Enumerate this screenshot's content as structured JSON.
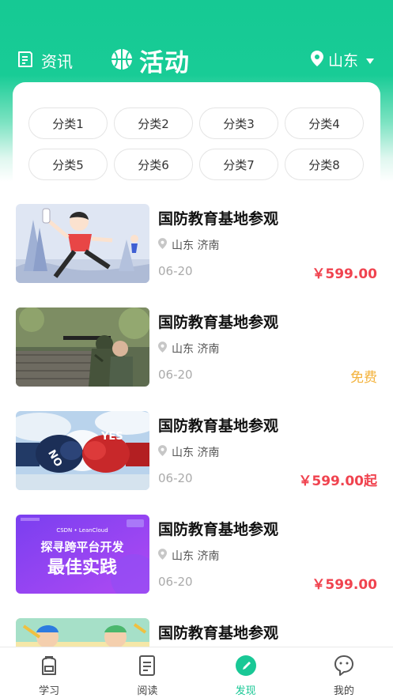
{
  "header": {
    "news_label": "资讯",
    "title": "活动",
    "location": "山东"
  },
  "categories": [
    "分类1",
    "分类2",
    "分类3",
    "分类4",
    "分类5",
    "分类6",
    "分类7",
    "分类8"
  ],
  "activities": [
    {
      "title": "国防教育基地参观",
      "location": "山东 济南",
      "date": "06-20",
      "price": "￥599.00",
      "free": false,
      "image": "cartoon-runner"
    },
    {
      "title": "国防教育基地参观",
      "location": "山东 济南",
      "date": "06-20",
      "price": "免费",
      "free": true,
      "image": "shooting-training"
    },
    {
      "title": "国防教育基地参观",
      "location": "山东 济南",
      "date": "06-20",
      "price": "￥599.00起",
      "free": false,
      "image": "boxing-gloves"
    },
    {
      "title": "国防教育基地参观",
      "location": "山东 济南",
      "date": "06-20",
      "price": "￥599.00",
      "free": false,
      "image": "csdn-banner"
    },
    {
      "title": "国防教育基地参观",
      "image": "cartoon-friends"
    }
  ],
  "banner": {
    "brand": "CSDN • LeanCloud",
    "line1": "探寻跨平台开发",
    "line2": "最佳实践"
  },
  "glove_text": {
    "left": "NO",
    "right": "YES"
  },
  "tabbar": [
    {
      "label": "学习",
      "icon": "backpack-icon",
      "active": false
    },
    {
      "label": "阅读",
      "icon": "document-icon",
      "active": false
    },
    {
      "label": "发现",
      "icon": "compass-icon",
      "active": true
    },
    {
      "label": "我的",
      "icon": "chat-bubble-icon",
      "active": false
    }
  ],
  "colors": {
    "brand_green": "#19c896",
    "price_red": "#f0434f",
    "free_yellow": "#f3b23b"
  }
}
